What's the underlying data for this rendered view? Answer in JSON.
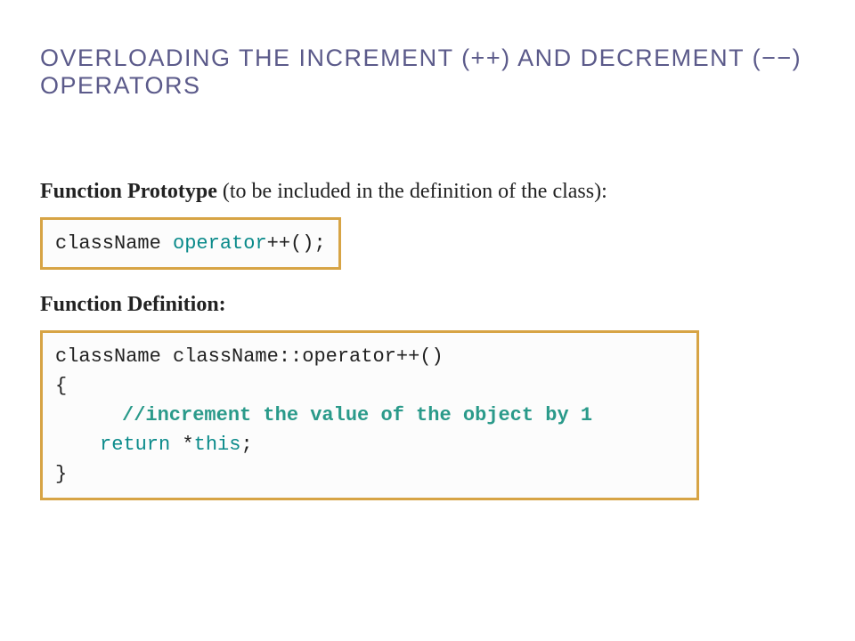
{
  "heading": "OVERLOADING THE INCREMENT (++) AND DECREMENT (−−) OPERATORS",
  "prototype": {
    "label_bold": "Function Prototype",
    "label_rest": " (to be included in the definition of the class):",
    "code": {
      "pre": "className ",
      "keyword": "operator",
      "post": "++();"
    }
  },
  "definition": {
    "label_bold": "Function Definition:",
    "code": {
      "line1": "className className::operator++()",
      "line2": "{",
      "line3_comment": "//increment the value of the object by 1",
      "line4_return": "return",
      "line4_star": " *",
      "line4_this": "this",
      "line4_semi": ";",
      "line5": "}"
    }
  }
}
